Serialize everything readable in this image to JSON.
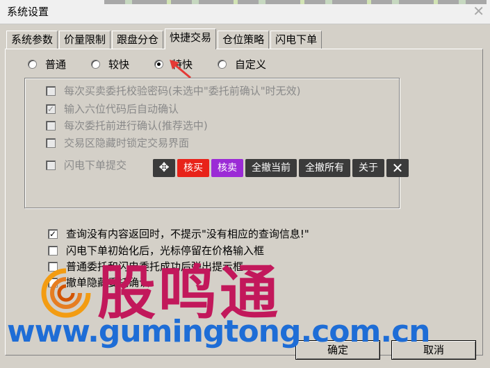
{
  "window": {
    "title": "系统设置",
    "close_glyph": "✕"
  },
  "tabs": [
    {
      "label": "系统参数"
    },
    {
      "label": "价量限制"
    },
    {
      "label": "跟盘分仓"
    },
    {
      "label": "快捷交易"
    },
    {
      "label": "仓位策略"
    },
    {
      "label": "闪电下单"
    }
  ],
  "active_tab": "快捷交易",
  "speed_options": [
    {
      "label": "普通",
      "selected": false
    },
    {
      "label": "较快",
      "selected": false
    },
    {
      "label": "特快",
      "selected": true
    },
    {
      "label": "自定义",
      "selected": false
    }
  ],
  "group_options": [
    {
      "label": "每次买卖委托校验密码(未选中\"委托前确认\"时无效)",
      "checked": false
    },
    {
      "label": "输入六位代码后自动确认",
      "checked": true
    },
    {
      "label": "每次委托前进行确认(推荐选中)",
      "checked": false
    },
    {
      "label": "交易区隐藏时锁定交易界面",
      "checked": false
    },
    {
      "label": "闪电下单提交",
      "checked": false
    }
  ],
  "toolbar": {
    "move_glyph": "✥",
    "buy": "核买",
    "sell": "核卖",
    "cancel_current": "全撤当前",
    "cancel_all": "全撤所有",
    "about": "关于",
    "close_glyph": "✕",
    "colors": {
      "buy": "#e8231a",
      "sell": "#9b2bd6",
      "default": "#3b3b3b"
    }
  },
  "bottom_options": [
    {
      "label": "查询没有内容返回时，不提示\"没有相应的查询信息!\"",
      "checked": true
    },
    {
      "label": "闪电下单初始化后，光标停留在价格输入框",
      "checked": false
    },
    {
      "label": "普通委托和闪电委托成功后弹出提示框",
      "checked": false
    },
    {
      "label": "撤单隐藏委托确认",
      "checked": false
    }
  ],
  "buttons": {
    "ok": "确定",
    "cancel": "取消"
  },
  "watermark": {
    "brand": "股鸣通",
    "url": "www.gumingtong.com.cn"
  }
}
